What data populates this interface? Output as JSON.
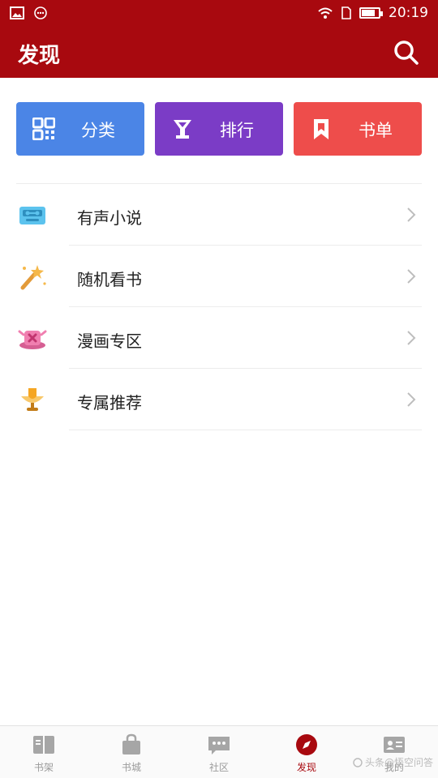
{
  "status_bar": {
    "time": "20:19",
    "icons": [
      "image-icon",
      "message-icon",
      "wifi-icon",
      "sim-icon",
      "battery-icon"
    ]
  },
  "header": {
    "title": "发现",
    "search_icon": "search-icon",
    "background_color": "#a8090f"
  },
  "quick_actions": [
    {
      "label": "分类",
      "icon": "grid-icon",
      "color": "#4b85e6"
    },
    {
      "label": "排行",
      "icon": "trophy-cup-icon",
      "color": "#7b3cc6"
    },
    {
      "label": "书单",
      "icon": "bookmark-icon",
      "color": "#ee4d4b"
    }
  ],
  "menu_items": [
    {
      "label": "有声小说",
      "icon": "audio-radio-icon"
    },
    {
      "label": "随机看书",
      "icon": "magic-wand-icon"
    },
    {
      "label": "漫画专区",
      "icon": "comic-hat-icon"
    },
    {
      "label": "专属推荐",
      "icon": "award-lamp-icon"
    }
  ],
  "bottom_nav": {
    "tabs": [
      {
        "label": "书架",
        "icon": "bookshelf-icon",
        "active": false
      },
      {
        "label": "书城",
        "icon": "shopping-bag-icon",
        "active": false
      },
      {
        "label": "社区",
        "icon": "chat-bubble-icon",
        "active": false
      },
      {
        "label": "发现",
        "icon": "compass-icon",
        "active": true
      },
      {
        "label": "我的",
        "icon": "profile-card-icon",
        "active": false
      }
    ],
    "active_color": "#a8090f",
    "watermark": "头条@悟空问答"
  }
}
